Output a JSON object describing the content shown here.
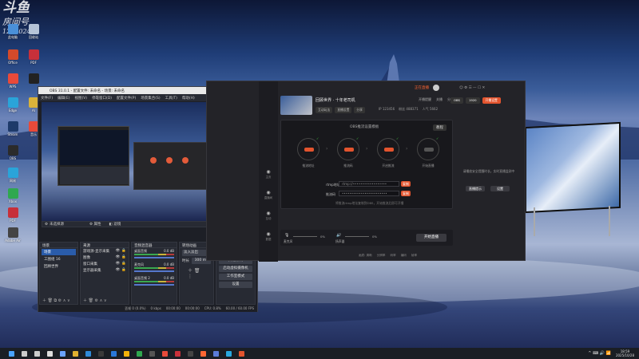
{
  "desktop": {
    "watermark": "斗鱼",
    "watermark_sub": "房间号",
    "watermark_id": "1282024",
    "icons": [
      {
        "label": "此电脑",
        "color": "#4a90d9"
      },
      {
        "label": "回收站",
        "color": "#b5c4d8"
      },
      {
        "label": "Office",
        "color": "#d44a2a"
      },
      {
        "label": "PDF",
        "color": "#c7303a"
      },
      {
        "label": "WPS",
        "color": "#e84a3a"
      },
      {
        "label": "",
        "color": "#222222"
      },
      {
        "label": "Edge",
        "color": "#2aa4d9"
      },
      {
        "label": "AI",
        "color": "#d9b23a"
      },
      {
        "label": "Steam",
        "color": "#1e3a6a"
      },
      {
        "label": "音乐",
        "color": "#e84a3a"
      },
      {
        "label": "OBS",
        "color": "#2b2b2b"
      },
      {
        "label": "网易",
        "color": "#2aa4d9"
      },
      {
        "label": "Xbox",
        "color": "#2fa84f"
      },
      {
        "label": "PDF",
        "color": "#c7303a"
      },
      {
        "label": "Adobe Air",
        "color": "#444444"
      }
    ]
  },
  "obs": {
    "title": "OBS 31.0.1 - 配置文件: 未命名 - 场景: 未命名",
    "menu": [
      "文件(F)",
      "编辑(E)",
      "视图(V)",
      "停靠窗口(D)",
      "配置文件(P)",
      "场景集合(S)",
      "工具(T)",
      "帮助(H)"
    ],
    "toolbar": {
      "label": "未选择源",
      "props": "属性",
      "filters": "滤镜"
    },
    "scenes": {
      "title": "场景",
      "items": [
        "场景",
        "工图组 16",
        "回顾世界"
      ]
    },
    "sources": {
      "title": "来源",
      "items": [
        "游戏源-显示采集",
        "图像",
        "窗口采集",
        "显示器采集"
      ]
    },
    "mixer": {
      "title": "音频混音器",
      "channels": [
        {
          "name": "桌面音频",
          "db": "0.0 dB"
        },
        {
          "name": "麦克风",
          "db": "0.0 dB"
        },
        {
          "name": "桌面音频 2",
          "db": "0.0 dB"
        }
      ]
    },
    "transitions": {
      "title": "转场动画",
      "type": "淡入淡出",
      "duration_label": "时长",
      "duration": "300 ms"
    },
    "controls": {
      "title": "控制按钮",
      "buttons": [
        "停止直播",
        "开始录制",
        "启动虚拟摄像机",
        "工作室模式",
        "设置"
      ]
    },
    "status": {
      "frames": "丢帧 0 (0.0%)",
      "bitrate": "0 kbps",
      "stream_time": "00:00:00",
      "rec_time": "00:00:00",
      "cpu": "CPU: 0.8%",
      "fps": "60.00 / 60.00 FPS"
    }
  },
  "app": {
    "top_badge": "正在直播",
    "header_links": [
      "开播提醒",
      "关播",
      "分享"
    ],
    "stream": {
      "name": "回顾世界 · 十年老司机",
      "tags": [
        "互动玩法",
        "直播设置",
        "分享"
      ],
      "stats": [
        "IP 123456",
        "粉丝 488371",
        "人气 5662"
      ]
    },
    "settings_badge": [
      "OBS",
      "1920",
      "开播设置"
    ],
    "push": {
      "section": "OBS推流设置模板",
      "steps": [
        "推流地址",
        "推流码",
        "开启推流",
        "开始直播"
      ],
      "rtmp_label": "rtmp地址",
      "rtmp_value": "rtmp://••••••••••••••••••",
      "code_label": "推流码",
      "code_value": "••••••••••••••••••••••••",
      "copy": "复制",
      "hint": "将推流rtmp地址复制到OBS，开始推流后即可开播",
      "help": "教程"
    },
    "right_panel": {
      "text": "请播放安全提醒时长，实时直播监测中",
      "btn1": "直播提示",
      "btn2": "设置"
    },
    "bottom": {
      "mic": "麦克风",
      "speaker": "扬声器",
      "vol1": "0%",
      "vol2": "0%",
      "start": "开始直播",
      "options": [
        "画质: 清晰",
        "分辨率",
        "码率",
        "编码",
        "帧率"
      ]
    },
    "nav_labels": [
      "主页",
      "直播间",
      "互动",
      "数据"
    ]
  },
  "taskbar": {
    "time": "18:59",
    "date": "2025/10/28"
  }
}
